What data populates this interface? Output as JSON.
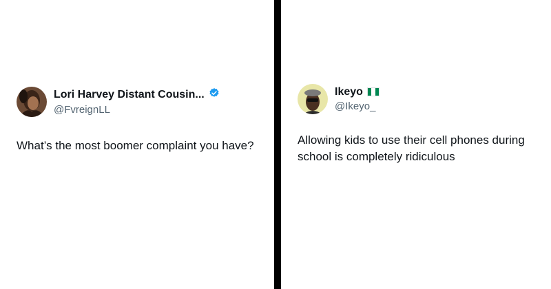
{
  "tweets": [
    {
      "display_name": "Lori Harvey Distant Cousin...",
      "handle": "@FvreignLL",
      "verified": true,
      "text": "What’s the most boomer complaint you have?"
    },
    {
      "display_name": "Ikeyo",
      "flag_icon": "nigeria-flag-icon",
      "handle": "@Ikeyo_",
      "verified": false,
      "text": "Allowing kids to use their cell phones during school is completely ridiculous"
    }
  ],
  "colors": {
    "text_primary": "#0f1419",
    "text_secondary": "#536471",
    "verified_blue": "#1d9bf0",
    "divider": "#000000",
    "flag_green": "#008751"
  }
}
